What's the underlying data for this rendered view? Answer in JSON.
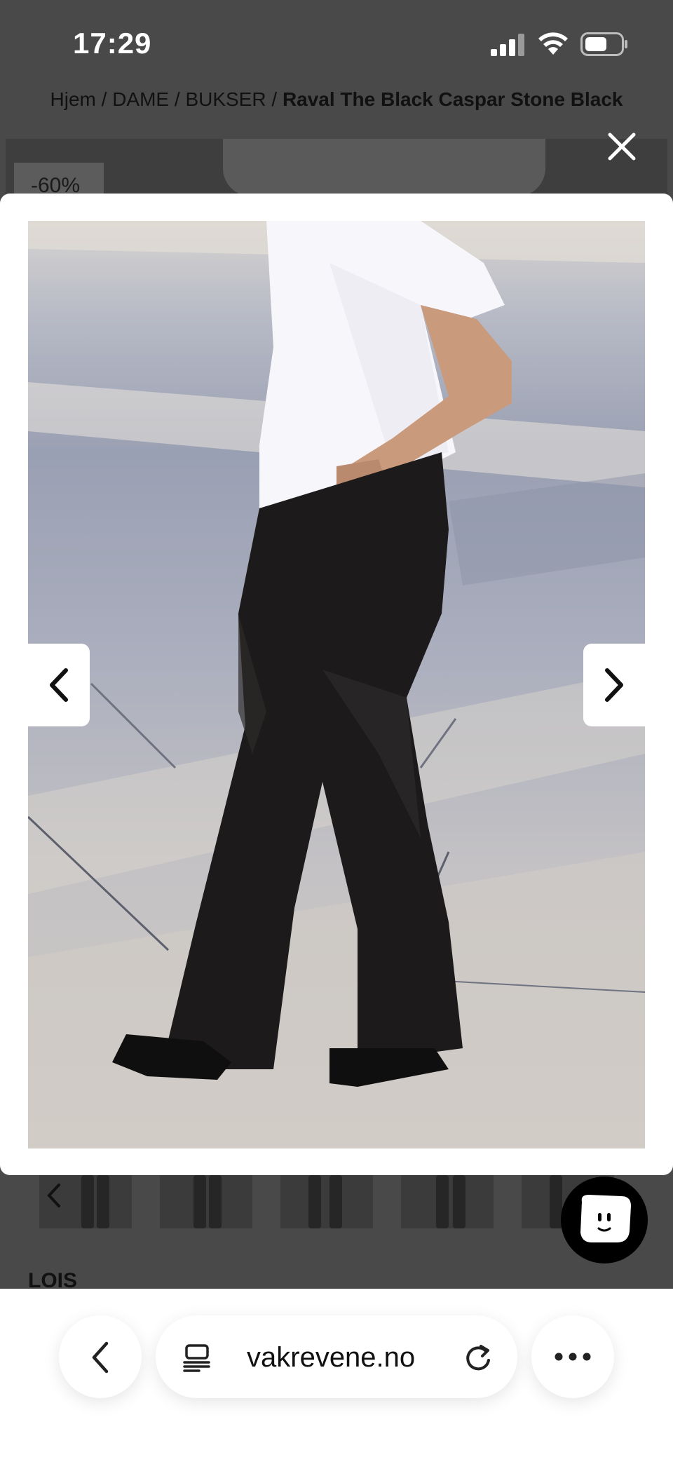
{
  "status_bar": {
    "time": "17:29"
  },
  "breadcrumb": {
    "items": [
      "Hjem",
      "DAME",
      "BUKSER"
    ],
    "separator": " / ",
    "current": "Raval The Black Caspar Stone Black"
  },
  "product": {
    "discount_badge": "-60%",
    "section_heading": "LOIS"
  },
  "gallery": {
    "close_icon": "close-icon",
    "prev_icon": "chevron-left-icon",
    "next_icon": "chevron-right-icon",
    "thumbnail_count": 5
  },
  "browser": {
    "url": "vakrevene.no",
    "back_icon": "chevron-left-icon",
    "tabs_icon": "tabs-icon",
    "reload_icon": "reload-icon",
    "more_icon": "more-icon"
  },
  "colors": {
    "overlay": "#494949",
    "modal_bg": "#ffffff",
    "chat_button": "#000000"
  }
}
